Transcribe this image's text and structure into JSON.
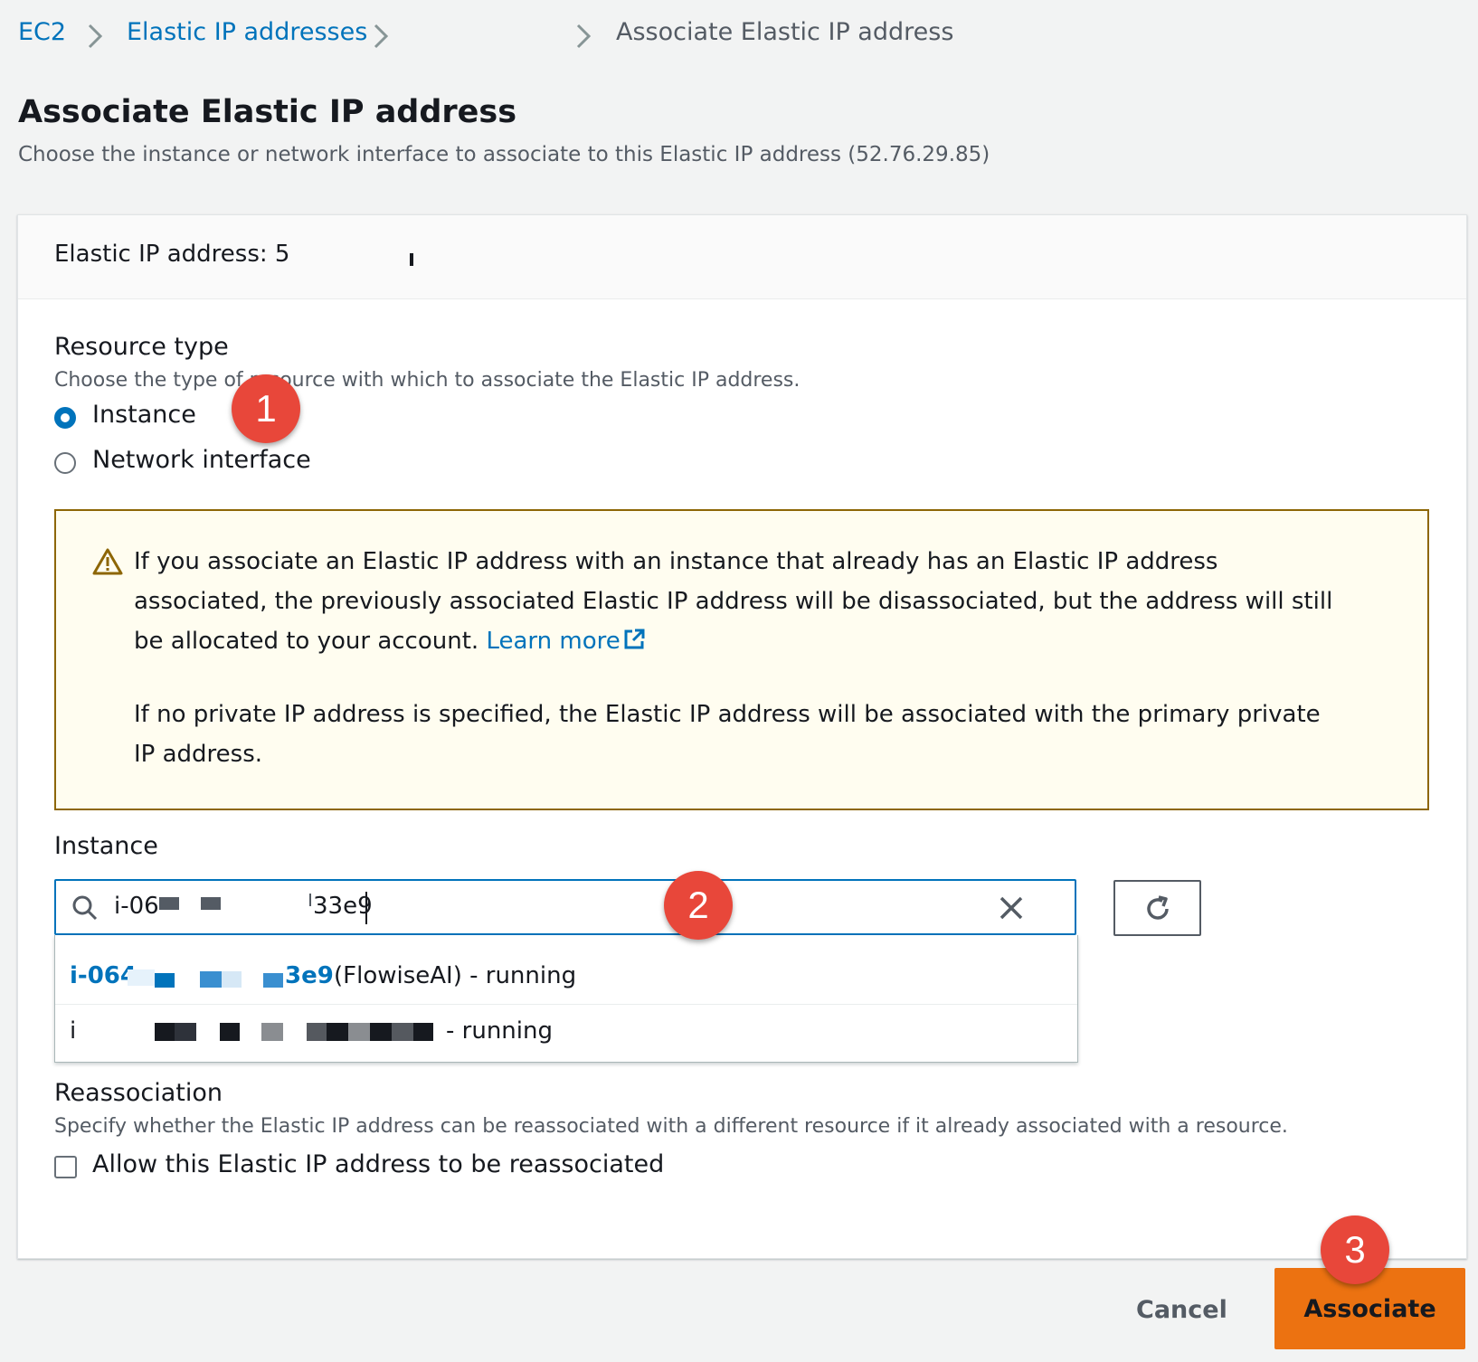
{
  "breadcrumb": {
    "items": [
      "EC2",
      "Elastic IP addresses",
      "Associate Elastic IP address"
    ]
  },
  "page": {
    "title": "Associate Elastic IP address",
    "description": "Choose the instance or network interface to associate to this Elastic IP address (52.76.29.85)"
  },
  "card": {
    "header": "Elastic IP address: 5",
    "resource_type": {
      "label": "Resource type",
      "description": "Choose the type of resource with which to associate the Elastic IP address.",
      "options": [
        {
          "label": "Instance",
          "selected": true
        },
        {
          "label": "Network interface",
          "selected": false
        }
      ]
    },
    "alert": {
      "line1": "If you associate an Elastic IP address with an instance that already has an Elastic IP address associated, the previously associated Elastic IP address will be disassociated, but the address will still be allocated to your account.",
      "link": "Learn more",
      "line2": "If no private IP address is specified, the Elastic IP address will be associated with the primary private IP address."
    },
    "instance": {
      "label": "Instance",
      "value_prefix": "i-06",
      "value_suffix": "33e9",
      "options": [
        {
          "id_prefix": "i-064",
          "id_suffix": "3e9",
          "name": "(FlowiseAI) - running"
        },
        {
          "id_prefix": "i",
          "name": "- running"
        }
      ]
    },
    "reassociation": {
      "label": "Reassociation",
      "description": "Specify whether the Elastic IP address can be reassociated with a different resource if it already associated with a resource.",
      "checkbox_label": "Allow this Elastic IP address to be reassociated",
      "checked": false
    }
  },
  "actions": {
    "cancel": "Cancel",
    "associate": "Associate"
  },
  "steps": [
    "1",
    "2",
    "3"
  ],
  "colors": {
    "link": "#0073bb",
    "primary": "#ec7211",
    "step_marker": "#e8473a",
    "alert_bg": "#fffdf0",
    "alert_border": "#8d6605"
  }
}
